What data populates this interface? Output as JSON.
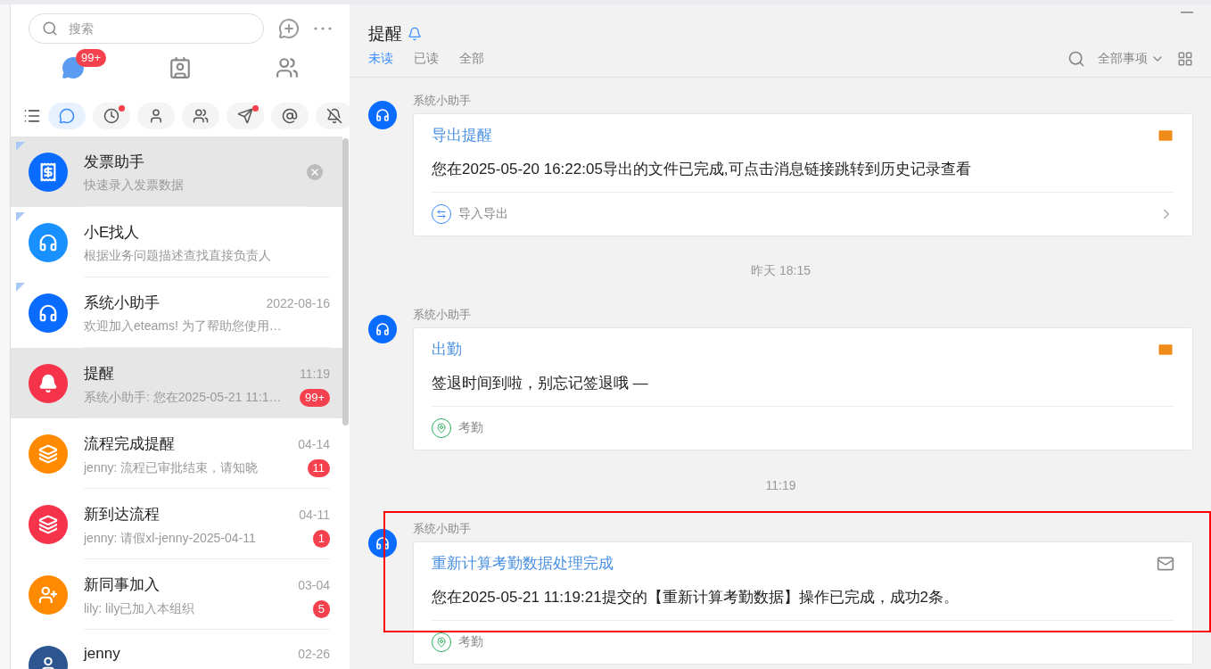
{
  "sidebar": {
    "search": {
      "placeholder": "搜索"
    },
    "nav": [
      {
        "kind": "chat",
        "selected": true,
        "badge": "99+"
      },
      {
        "kind": "contacts",
        "selected": false
      },
      {
        "kind": "groups",
        "selected": false
      }
    ],
    "filters": [
      {
        "kind": "chat",
        "selected": true,
        "dot": false
      },
      {
        "kind": "clock",
        "selected": false,
        "dot": true
      },
      {
        "kind": "person",
        "selected": false,
        "dot": false
      },
      {
        "kind": "group",
        "selected": false,
        "dot": false
      },
      {
        "kind": "send",
        "selected": false,
        "dot": true
      },
      {
        "kind": "at",
        "selected": false,
        "dot": false
      },
      {
        "kind": "mute",
        "selected": false,
        "dot": false
      }
    ],
    "chats": [
      {
        "kind": "receipt",
        "color": "#0a6cff",
        "title": "发票助手",
        "preview": "快速录入发票数据",
        "pinned": true,
        "selected": true,
        "hovered": true
      },
      {
        "kind": "ebot",
        "color": "#1890ff",
        "title": "小E找人",
        "preview": "根据业务问题描述查找直接负责人",
        "pinned": true,
        "selected": false,
        "hovered": false
      },
      {
        "kind": "headset",
        "color": "#0a6cff",
        "title": "系统小助手",
        "time": "2022-08-16",
        "preview": "欢迎加入eteams! 为了帮助您使用…",
        "pinned": true,
        "selected": false,
        "hovered": false
      },
      {
        "kind": "bell",
        "color": "#f5334a",
        "title": "提醒",
        "time": "11:19",
        "preview": "系统小助手: 您在2025-05-21 11:1…",
        "badge": "99+",
        "pinned": false,
        "selected": true,
        "hovered": false
      },
      {
        "kind": "flowdone",
        "color": "#ff8a00",
        "title": "流程完成提醒",
        "time": "04-14",
        "preview": "jenny: 流程已审批结束，请知晓",
        "badge": "11",
        "pinned": false,
        "selected": false,
        "hovered": false
      },
      {
        "kind": "flownew",
        "color": "#f5334a",
        "title": "新到达流程",
        "time": "04-11",
        "preview": "jenny: 请假xl-jenny-2025-04-11",
        "badge": "1",
        "pinned": false,
        "selected": false,
        "hovered": false
      },
      {
        "kind": "useradd",
        "color": "#ff8a00",
        "title": "新同事加入",
        "time": "03-04",
        "preview": "lily: lily已加入本组织",
        "badge": "5",
        "pinned": false,
        "selected": false,
        "hovered": false
      },
      {
        "kind": "person",
        "color": "#2d5590",
        "title": "jenny",
        "time": "02-26",
        "pinned": false,
        "selected": false,
        "hovered": false
      }
    ]
  },
  "main": {
    "title": "提醒",
    "tabs": [
      {
        "label": "未读",
        "selected": true
      },
      {
        "label": "已读",
        "selected": false
      },
      {
        "label": "全部",
        "selected": false
      }
    ],
    "filter": "全部事项",
    "feed": [
      {
        "kind": "message",
        "sender": "系统小助手",
        "title": "导出提醒",
        "body": "您在2025-05-20 16:22:05导出的文件已完成,可点击消息链接跳转到历史记录查看",
        "footer": {
          "kind": "transfer",
          "label": "导入导出"
        },
        "unread": true,
        "highlighted": false,
        "link": true
      },
      {
        "kind": "time",
        "text": "昨天 18:15"
      },
      {
        "kind": "message",
        "sender": "系统小助手",
        "title": "出勤",
        "body": "签退时间到啦，别忘记签退哦 —",
        "footer": {
          "kind": "location",
          "label": "考勤"
        },
        "unread": true,
        "highlighted": false,
        "link": false
      },
      {
        "kind": "time",
        "text": "11:19"
      },
      {
        "kind": "message",
        "sender": "系统小助手",
        "title": "重新计算考勤数据处理完成",
        "body": "您在2025-05-21 11:19:21提交的【重新计算考勤数据】操作已完成，成功2条。",
        "footer": {
          "kind": "location",
          "label": "考勤"
        },
        "unread": false,
        "highlighted": true,
        "link": false
      }
    ]
  }
}
